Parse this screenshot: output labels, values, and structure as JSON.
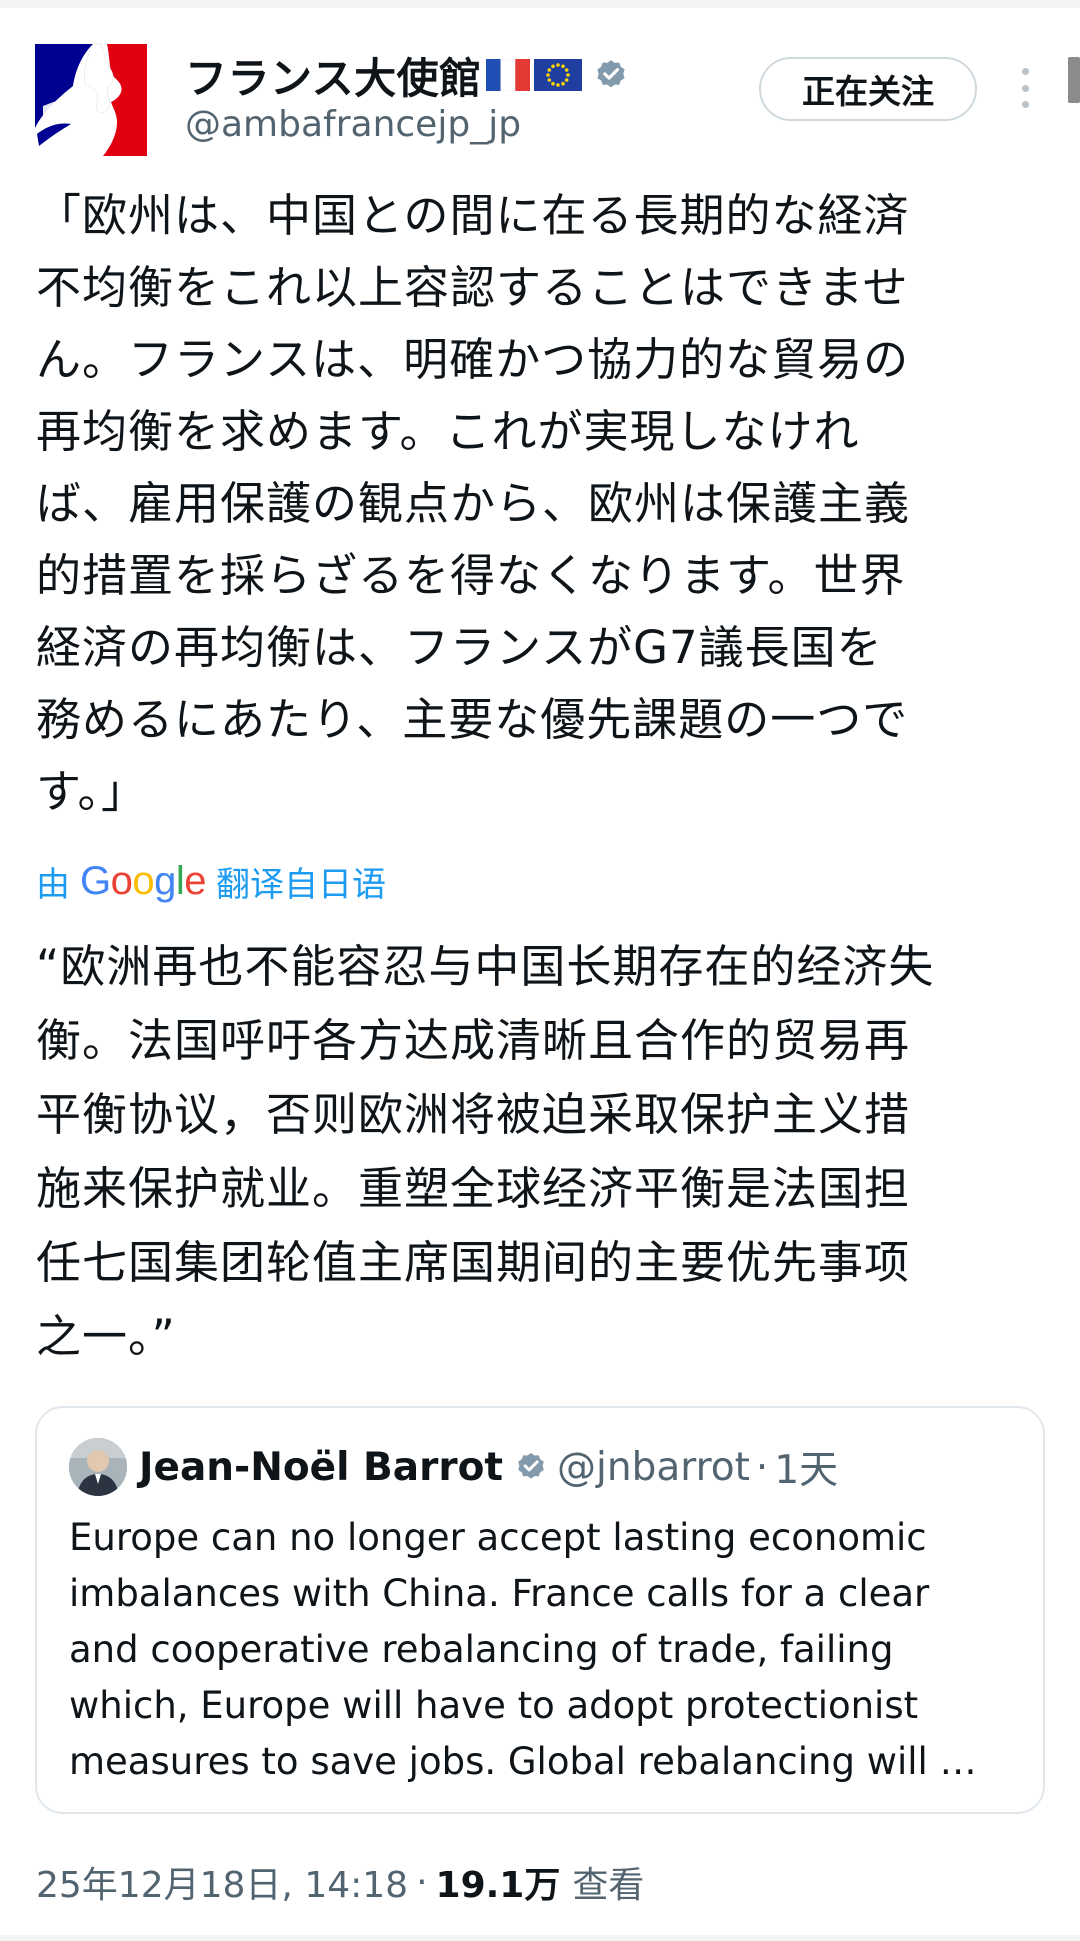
{
  "colors": {
    "accent": "#1d9bf0",
    "verified": "#829aab",
    "muted": "#536471",
    "text": "#0f1419",
    "border": "#cfd9de"
  },
  "author": {
    "display_name": "フランス大使館",
    "flag_icons": [
      "flag-france-icon",
      "flag-eu-icon"
    ],
    "handle": "@ambafrancejp_jp"
  },
  "follow_button": {
    "label": "正在关注"
  },
  "post": {
    "original_text": "「欧州は、中国との間に在る長期的な経済\n不均衡をこれ以上容認することはできませ\nん。フランスは、明確かつ協力的な貿易の\n再均衡を求めます。これが実現しなけれ\nば、雇用保護の観点から、欧州は保護主義\n的措置を採らざるを得なくなります。世界\n経済の再均衡は、フランスがG7議長国を\n務めるにあたり、主要な優先課題の一つで\nす。」",
    "translation": {
      "prefix": "由",
      "provider": "Google",
      "suffix": "翻译自日语"
    },
    "translated_text": "“欧洲再也不能容忍与中国长期存在的经济失\n衡。法国呼吁各方达成清晰且合作的贸易再\n平衡协议，否则欧洲将被迫采取保护主义措\n施来保护就业。重塑全球经济平衡是法国担\n任七国集团轮值主席国期间的主要优先事项\n之一。”"
  },
  "quoted_post": {
    "display_name": "Jean-Noël Barrot",
    "handle": "@jnbarrot",
    "separator": "·",
    "time": "1天",
    "text": "Europe can no longer accept lasting economic\nimbalances with China. France calls for a clear\nand cooperative rebalancing of trade, failing\nwhich, Europe will have to adopt protectionist\nmeasures to save jobs. Global rebalancing will …"
  },
  "meta": {
    "timestamp": "25年12月18日, 14:18",
    "separator": "·",
    "views_count": "19.1万",
    "views_label": "查看"
  }
}
